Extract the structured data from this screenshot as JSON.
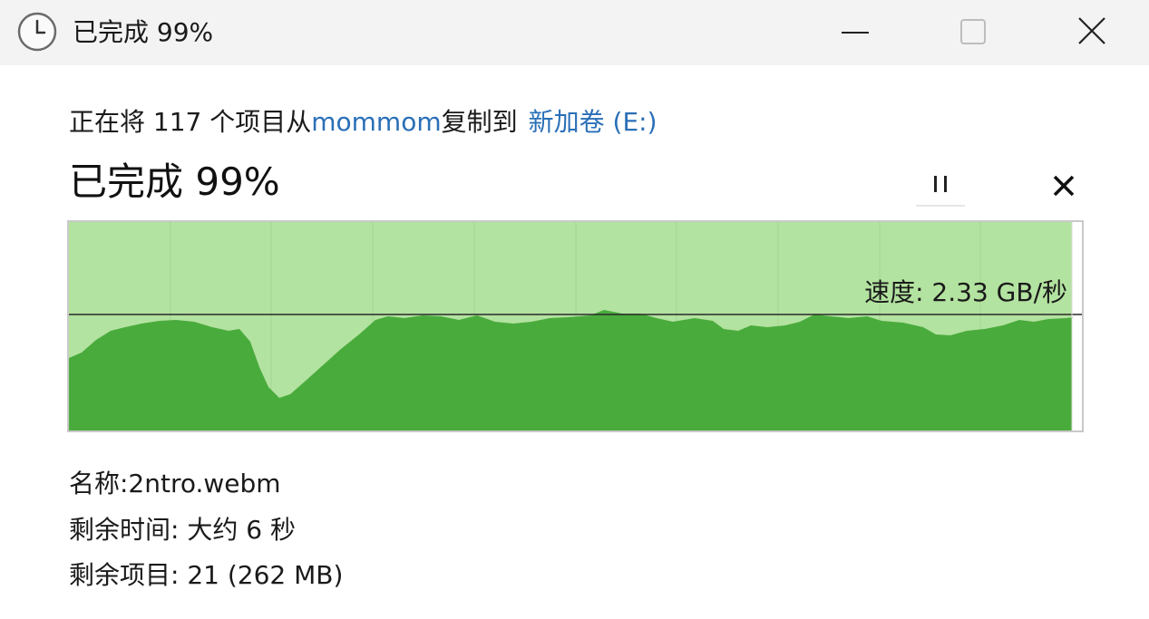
{
  "window": {
    "title": "已完成 99%",
    "icon": "clock-icon",
    "controls": [
      "minimize-icon",
      "maximize-icon",
      "close-icon"
    ]
  },
  "copy": {
    "prefix": "正在将 117 个项目从",
    "source": "mommom",
    "middle": "复制到",
    "destination": "新加卷 (E:)"
  },
  "status": {
    "label": "已完成 99%",
    "percent": 99
  },
  "graph": {
    "speed_label": "速度: 2.33 GB/秒",
    "fill_light": "#b3e3a0",
    "fill_dark": "#4aab3d",
    "progress_fraction": 0.99,
    "speed_line_fraction": 0.55
  },
  "details": {
    "name": "名称:2ntro.webm",
    "time_remaining": "剩余时间: 大约 6 秒",
    "items_remaining": "剩余项目: 21 (262 MB)"
  },
  "colors": {
    "link": "#2a6fb7",
    "titlebar": "#f3f3f3"
  }
}
